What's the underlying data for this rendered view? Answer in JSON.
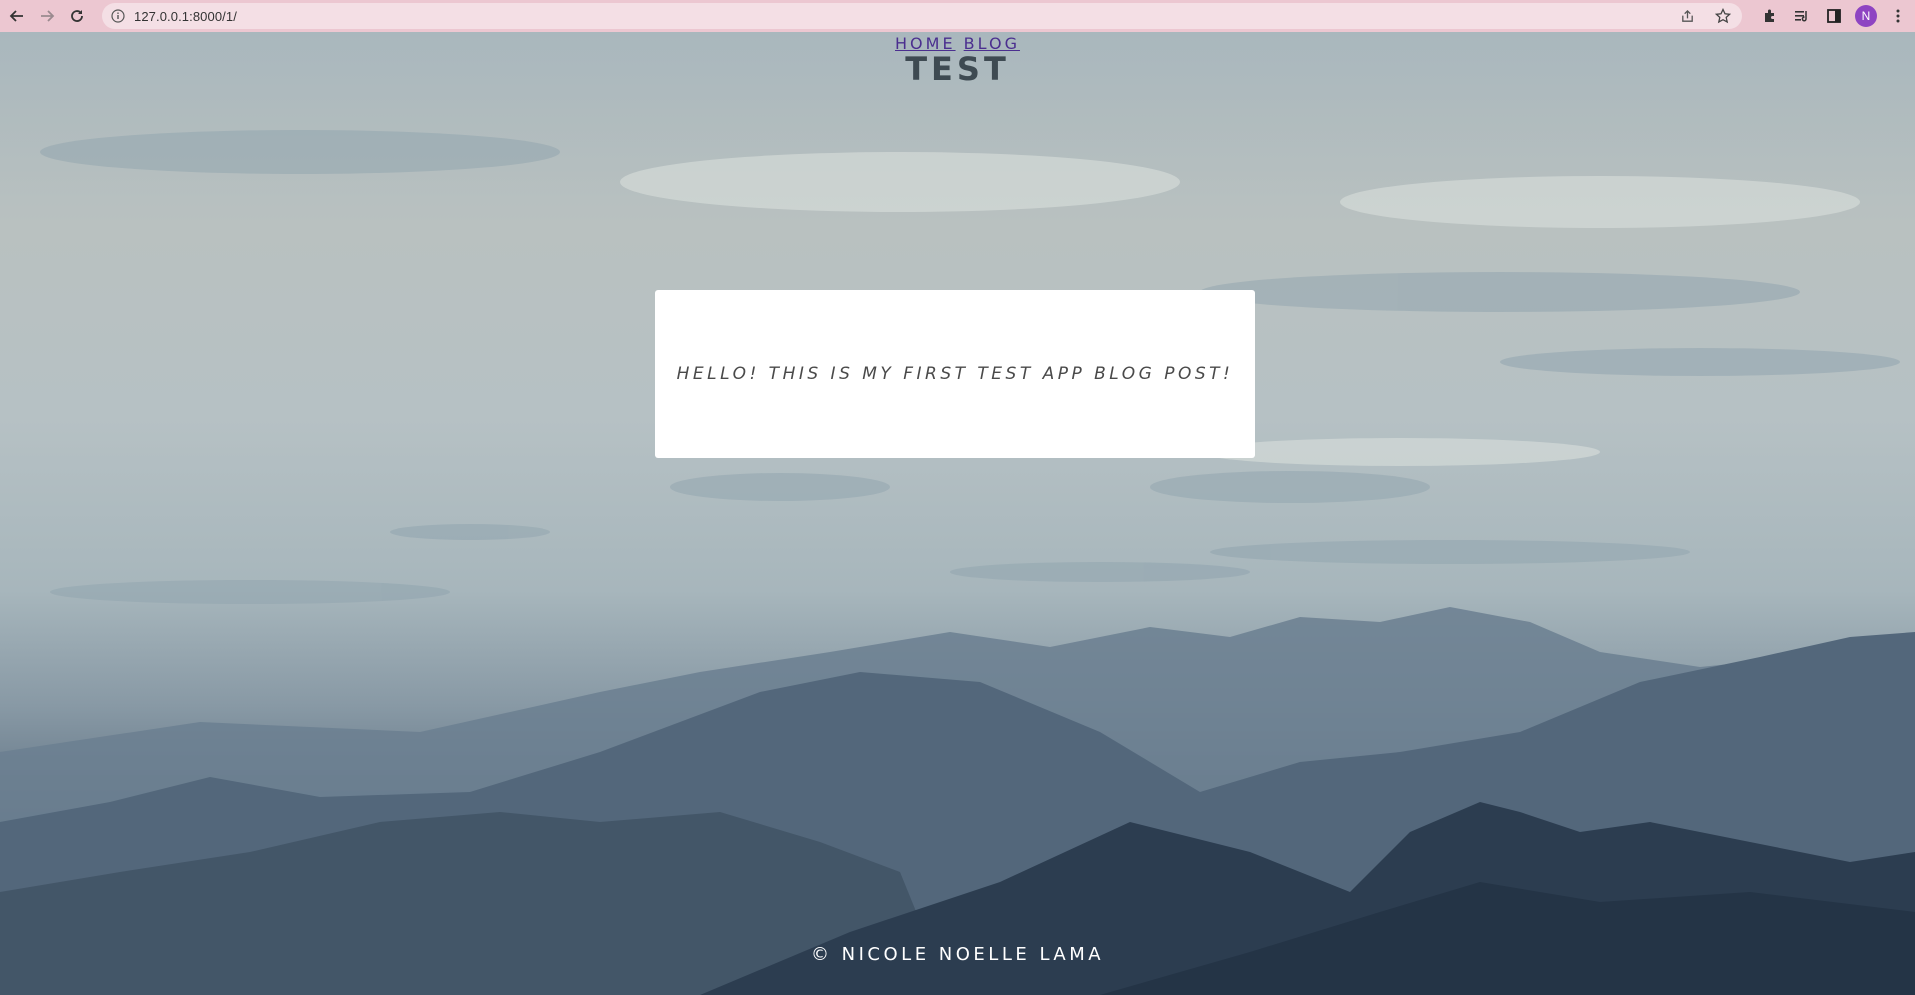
{
  "browser": {
    "url": "127.0.0.1:8000/1/",
    "profile_initial": "N"
  },
  "site": {
    "nav": [
      {
        "label": "HOME"
      },
      {
        "label": "BLOG"
      }
    ],
    "title": "TEST",
    "post_text": "HELLO! THIS IS MY FIRST TEST APP BLOG POST!",
    "footer": "© NICOLE NOELLE LAMA"
  },
  "colors": {
    "chrome": "#ecc7d1",
    "link": "#4b2f8f",
    "title": "#3e4a52",
    "avatar": "#8e44c2"
  }
}
